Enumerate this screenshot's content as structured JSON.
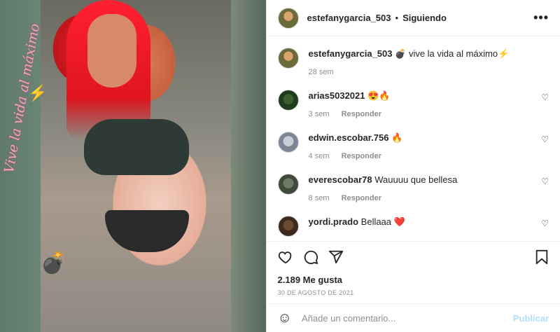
{
  "post": {
    "username": "estefanygarcia_503",
    "separator": "•",
    "follow_status": "Siguiendo",
    "more_label": "•••",
    "image_overlay_text": "Vive la vida al máximo",
    "caption": {
      "username": "estefanygarcia_503",
      "text": "💣 vive la vida al máximo⚡",
      "time": "28 sem"
    },
    "comments": [
      {
        "username": "arias5032021",
        "text": "😍🔥",
        "time": "3 sem",
        "reply": "Responder"
      },
      {
        "username": "edwin.escobar.756",
        "text": "🔥",
        "time": "4 sem",
        "reply": "Responder"
      },
      {
        "username": "everescobar78",
        "text": "Wauuuu que bellesa",
        "time": "8 sem",
        "reply": "Responder"
      },
      {
        "username": "yordi.prado",
        "text": "Bellaaa ❤️",
        "time": "",
        "reply": ""
      }
    ],
    "likes": "2.189 Me gusta",
    "date": "30 DE AGOSTO DE 2021",
    "add_comment": {
      "placeholder": "Añade un comentario...",
      "submit_label": "Publicar"
    }
  },
  "colors": {
    "text": "#262626",
    "muted": "#8e8e8e",
    "publish_disabled": "#b2dffc",
    "heart_red": "#ed4956"
  },
  "icons": [
    "like-icon",
    "comment-icon",
    "share-icon",
    "save-icon",
    "emoji-icon",
    "small-heart-icon"
  ]
}
